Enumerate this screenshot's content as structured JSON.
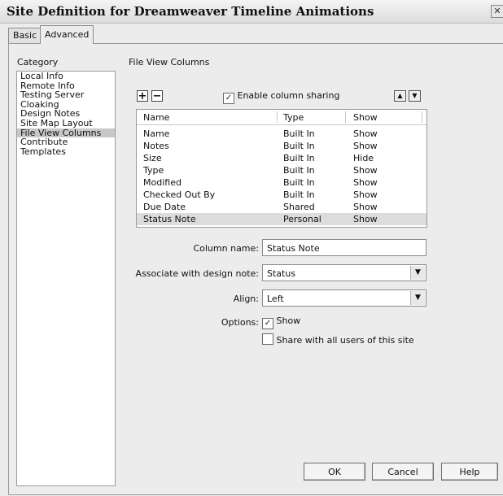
{
  "window": {
    "title": "Site Definition for Dreamweaver Timeline Animations"
  },
  "tabs": [
    {
      "label": "Basic"
    },
    {
      "label": "Advanced"
    }
  ],
  "category": {
    "label": "Category",
    "items": [
      "Local Info",
      "Remote Info",
      "Testing Server",
      "Cloaking",
      "Design Notes",
      "Site Map Layout",
      "File View Columns",
      "Contribute",
      "Templates"
    ],
    "selected": "File View Columns"
  },
  "section": {
    "title": "File View Columns"
  },
  "toolbar": {
    "enable_sharing_label": "Enable column sharing",
    "enable_sharing_checked": true
  },
  "columns_table": {
    "headers": [
      "Name",
      "Type",
      "Show"
    ],
    "rows": [
      [
        "Name",
        "Built In",
        "Show"
      ],
      [
        "Notes",
        "Built In",
        "Show"
      ],
      [
        "Size",
        "Built In",
        "Hide"
      ],
      [
        "Type",
        "Built In",
        "Show"
      ],
      [
        "Modified",
        "Built In",
        "Show"
      ],
      [
        "Checked Out By",
        "Built In",
        "Show"
      ],
      [
        "Due Date",
        "Shared",
        "Show"
      ],
      [
        "Status Note",
        "Personal",
        "Show"
      ]
    ],
    "selected_row": 7
  },
  "form": {
    "column_name_label": "Column name:",
    "column_name_value": "Status Note",
    "associate_label": "Associate with design note:",
    "associate_value": "Status",
    "align_label": "Align:",
    "align_value": "Left",
    "options_label": "Options:",
    "show_label": "Show",
    "show_checked": true,
    "share_label": "Share with all users of this site",
    "share_checked": false
  },
  "buttons": {
    "ok": "OK",
    "cancel": "Cancel",
    "help": "Help"
  }
}
